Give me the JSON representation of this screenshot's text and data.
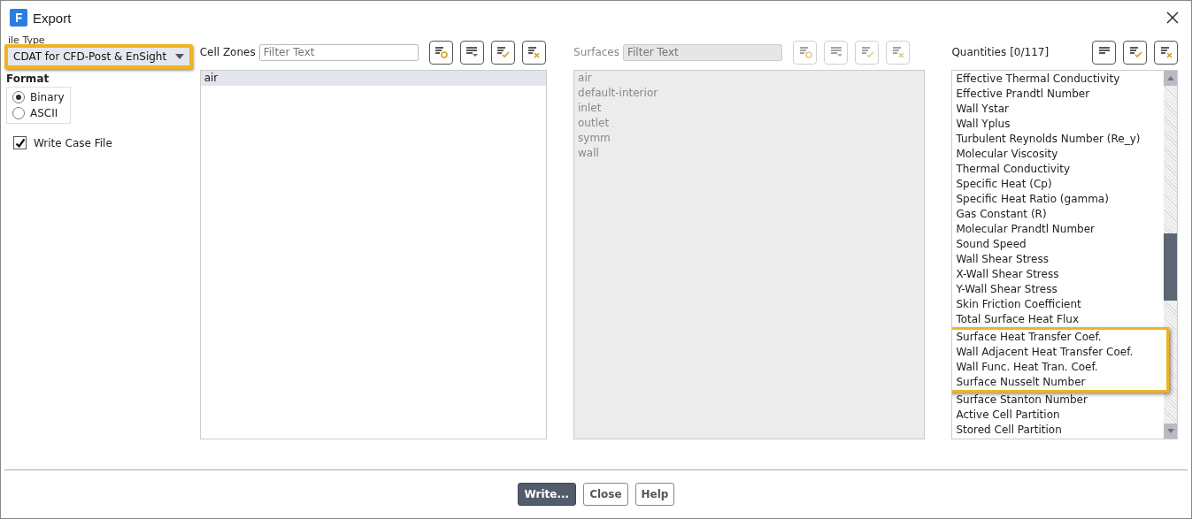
{
  "window": {
    "title": "Export"
  },
  "file_type": {
    "label": "ile Type",
    "value": "CDAT for CFD-Post & EnSight",
    "highlighted": true
  },
  "format": {
    "label": "Format",
    "options": [
      {
        "label": "Binary",
        "selected": true
      },
      {
        "label": "ASCII",
        "selected": false
      }
    ]
  },
  "write_case_file": {
    "label": "Write Case File",
    "checked": true
  },
  "cell_zones": {
    "label": "Cell Zones",
    "placeholder": "Filter Text",
    "disabled": false,
    "items": [
      {
        "label": "air",
        "selected": true
      }
    ]
  },
  "surfaces": {
    "label": "Surfaces",
    "placeholder": "Filter Text",
    "disabled": true,
    "items": [
      {
        "label": "air",
        "selected": false
      },
      {
        "label": "default-interior",
        "selected": false
      },
      {
        "label": "inlet",
        "selected": false
      },
      {
        "label": "outlet",
        "selected": false
      },
      {
        "label": "symm",
        "selected": false
      },
      {
        "label": "wall",
        "selected": false
      }
    ]
  },
  "quantities": {
    "label": "Quantities",
    "count": "[0/117]",
    "items": [
      {
        "label": "Effective Thermal Conductivity",
        "highlighted": false
      },
      {
        "label": "Effective Prandtl Number",
        "highlighted": false
      },
      {
        "label": "Wall Ystar",
        "highlighted": false
      },
      {
        "label": "Wall Yplus",
        "highlighted": false
      },
      {
        "label": "Turbulent Reynolds Number (Re_y)",
        "highlighted": false
      },
      {
        "label": "Molecular Viscosity",
        "highlighted": false
      },
      {
        "label": "Thermal Conductivity",
        "highlighted": false
      },
      {
        "label": "Specific Heat (Cp)",
        "highlighted": false
      },
      {
        "label": "Specific Heat Ratio (gamma)",
        "highlighted": false
      },
      {
        "label": "Gas Constant (R)",
        "highlighted": false
      },
      {
        "label": "Molecular Prandtl Number",
        "highlighted": false
      },
      {
        "label": "Sound Speed",
        "highlighted": false
      },
      {
        "label": "Wall Shear Stress",
        "highlighted": false
      },
      {
        "label": "X-Wall Shear Stress",
        "highlighted": false
      },
      {
        "label": "Y-Wall Shear Stress",
        "highlighted": false
      },
      {
        "label": "Skin Friction Coefficient",
        "highlighted": false
      },
      {
        "label": "Total Surface Heat Flux",
        "highlighted": false
      },
      {
        "label": "Surface Heat Transfer Coef.",
        "highlighted": true
      },
      {
        "label": "Wall Adjacent Heat Transfer Coef.",
        "highlighted": true
      },
      {
        "label": "Wall Func. Heat Tran. Coef.",
        "highlighted": true
      },
      {
        "label": "Surface Nusselt Number",
        "highlighted": true
      },
      {
        "label": "Surface Stanton Number",
        "highlighted": false
      },
      {
        "label": "Active Cell Partition",
        "highlighted": false
      },
      {
        "label": "Stored Cell Partition",
        "highlighted": false
      }
    ]
  },
  "buttons": [
    {
      "label": "Write...",
      "kind": "primary"
    },
    {
      "label": "Close",
      "kind": "normal"
    },
    {
      "label": "Help",
      "kind": "normal"
    }
  ]
}
